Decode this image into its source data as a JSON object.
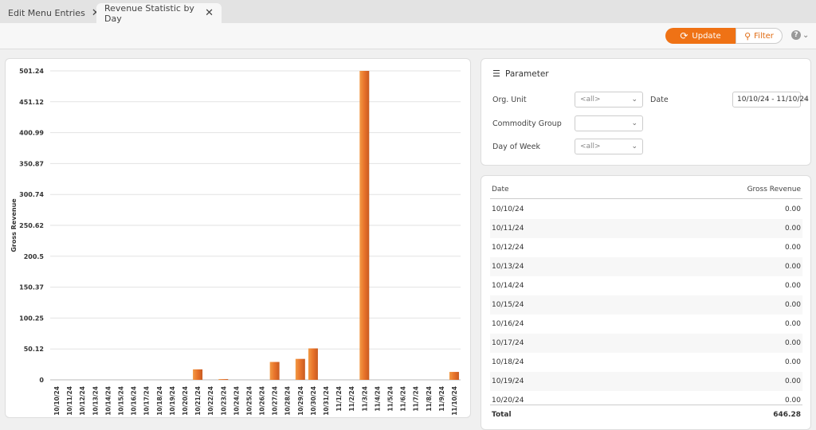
{
  "tabs": [
    {
      "label": "Edit Menu Entries",
      "active": false
    },
    {
      "label": "Revenue Statistic by Day",
      "active": true
    }
  ],
  "toolbar": {
    "update_label": "Update",
    "filter_label": "Filter",
    "help_icon": "?",
    "accent": "#ef7215"
  },
  "parameter": {
    "title": "Parameter",
    "org_unit_label": "Org. Unit",
    "org_unit_value": "<all>",
    "date_label": "Date",
    "date_value": "10/10/24 - 11/10/24",
    "commodity_label": "Commodity Group",
    "commodity_value": "",
    "dow_label": "Day of Week",
    "dow_value": "<all>"
  },
  "table": {
    "col_date": "Date",
    "col_revenue": "Gross Revenue",
    "rows": [
      [
        "10/10/24",
        "0.00"
      ],
      [
        "10/11/24",
        "0.00"
      ],
      [
        "10/12/24",
        "0.00"
      ],
      [
        "10/13/24",
        "0.00"
      ],
      [
        "10/14/24",
        "0.00"
      ],
      [
        "10/15/24",
        "0.00"
      ],
      [
        "10/16/24",
        "0.00"
      ],
      [
        "10/17/24",
        "0.00"
      ],
      [
        "10/18/24",
        "0.00"
      ],
      [
        "10/19/24",
        "0.00"
      ],
      [
        "10/20/24",
        "0.00"
      ]
    ],
    "total_label": "Total",
    "total_value": "646.28"
  },
  "chart_data": {
    "type": "bar",
    "ylabel": "Gross Revenue",
    "xlabel": "",
    "ylim": [
      0,
      501.24
    ],
    "grid": true,
    "yticks": [
      "0",
      "50.12",
      "100.25",
      "150.37",
      "200.5",
      "250.62",
      "300.74",
      "350.87",
      "400.99",
      "451.12",
      "501.24"
    ],
    "categories": [
      "10/10/24",
      "10/11/24",
      "10/12/24",
      "10/13/24",
      "10/14/24",
      "10/15/24",
      "10/16/24",
      "10/17/24",
      "10/18/24",
      "10/19/24",
      "10/20/24",
      "10/21/24",
      "10/22/24",
      "10/23/24",
      "10/24/24",
      "10/25/24",
      "10/26/24",
      "10/27/24",
      "10/28/24",
      "10/29/24",
      "10/30/24",
      "10/31/24",
      "11/1/24",
      "11/2/24",
      "11/3/24",
      "11/4/24",
      "11/5/24",
      "11/6/24",
      "11/7/24",
      "11/8/24",
      "11/9/24",
      "11/10/24"
    ],
    "values": [
      0,
      0,
      0,
      0,
      0,
      0,
      0,
      0,
      0,
      0,
      0,
      17,
      0,
      1.2,
      0,
      0,
      0,
      29,
      0,
      34,
      51,
      0,
      0,
      0,
      501.24,
      0,
      0,
      0,
      0,
      0,
      0,
      12.84
    ],
    "bar_color": "#e8732a"
  }
}
